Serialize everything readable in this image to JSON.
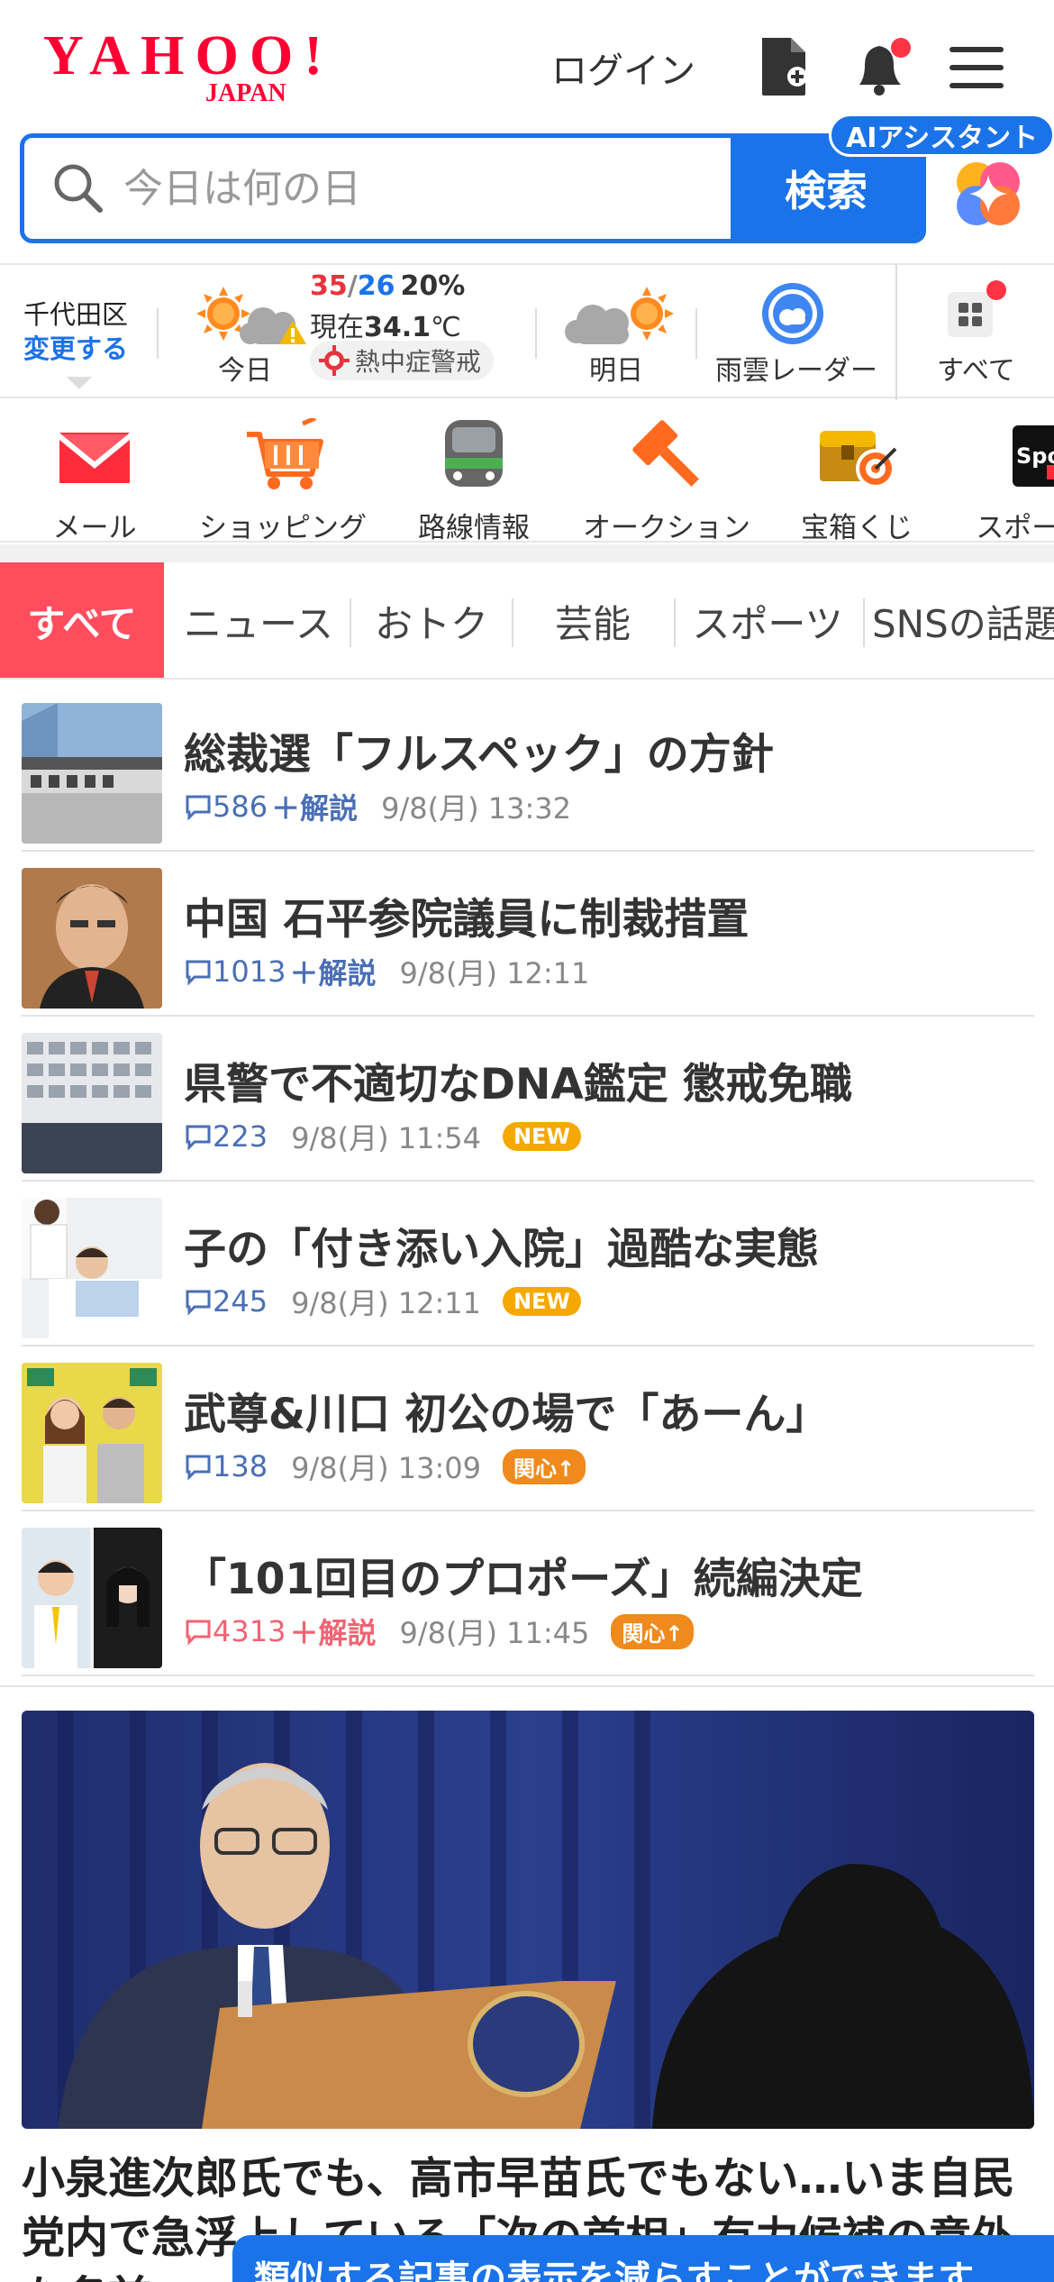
{
  "header": {
    "logo_text": "YAHOO!",
    "logo_sub": "JAPAN",
    "login_label": "ログイン"
  },
  "search": {
    "placeholder": "今日は何の日",
    "button_label": "検索",
    "ai_badge": "AIアシスタント"
  },
  "weather": {
    "location": "千代田区",
    "change_label": "変更する",
    "today_label": "今日",
    "high": "35",
    "slash": "/",
    "low": "26",
    "rain": "20%",
    "now_prefix": "現在",
    "now_temp": "34.1",
    "now_unit": "℃",
    "alert": "熱中症警戒",
    "tomorrow_label": "明日",
    "radar_label": "雨雲レーダー",
    "all_label": "すべて"
  },
  "services": [
    {
      "label": "メール",
      "icon": "mail-icon"
    },
    {
      "label": "ショッピング",
      "icon": "shopping-cart-icon"
    },
    {
      "label": "路線情報",
      "icon": "train-icon"
    },
    {
      "label": "オークション",
      "icon": "auction-hammer-icon"
    },
    {
      "label": "宝箱くじ",
      "icon": "treasure-box-icon"
    },
    {
      "label": "スポーツ",
      "icon": "sports-icon"
    }
  ],
  "tabs": [
    "すべて",
    "ニュース",
    "おトク",
    "芸能",
    "スポーツ",
    "SNSの話題"
  ],
  "news": [
    {
      "title": "総裁選「フルスペック」の方針",
      "comments": "586",
      "kaisetsu": "＋解説",
      "time": "9/8(月) 13:32",
      "badge": ""
    },
    {
      "title": "中国 石平参院議員に制裁措置",
      "comments": "1013",
      "kaisetsu": "＋解説",
      "time": "9/8(月) 12:11",
      "badge": ""
    },
    {
      "title": "県警で不適切なDNA鑑定 懲戒免職",
      "comments": "223",
      "kaisetsu": "",
      "time": "9/8(月) 11:54",
      "badge": "NEW"
    },
    {
      "title": "子の「付き添い入院」過酷な実態",
      "comments": "245",
      "kaisetsu": "",
      "time": "9/8(月) 12:11",
      "badge": "NEW"
    },
    {
      "title": "武尊&川口 初公の場で「あーん」",
      "comments": "138",
      "kaisetsu": "",
      "time": "9/8(月) 13:09",
      "badge": "関心↑"
    },
    {
      "title": "「101回目のプロポーズ」続編決定",
      "comments": "4313",
      "kaisetsu": "＋解説",
      "time": "9/8(月) 11:45",
      "badge": "関心↑"
    }
  ],
  "feature": {
    "title": "小泉進次郎氏でも、高市早苗氏でもない…いま自民党内で急浮上している「次の首相」有力候補の意外な名前"
  },
  "toast": {
    "text": "類似する記事の表示を減らすことができます"
  },
  "colors": {
    "accent": "#1a73e8",
    "tab_active": "#ff4d5e",
    "logo_red": "#ff0033",
    "badge_new": "#f5a800",
    "badge_interest": "#f08a1c"
  }
}
